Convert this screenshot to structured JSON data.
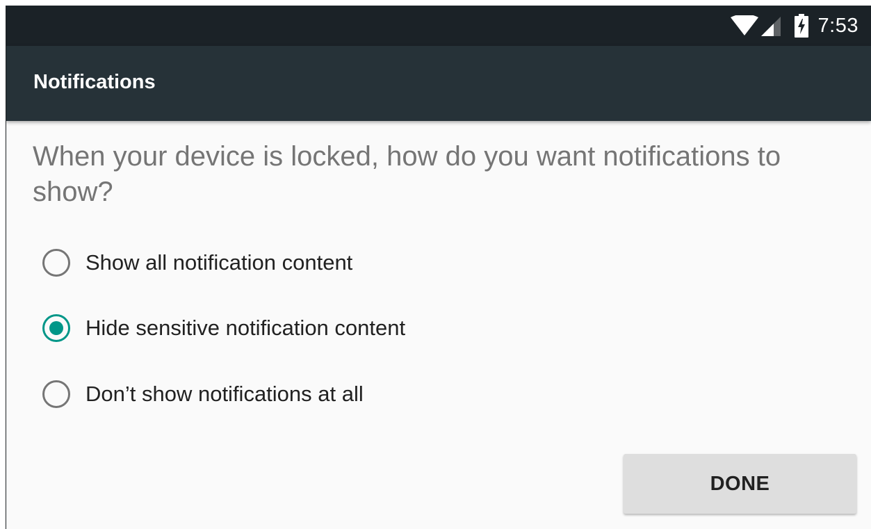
{
  "status_bar": {
    "time": "7:53",
    "icons": [
      "wifi-icon",
      "cellular-signal-icon",
      "battery-charging-icon"
    ]
  },
  "toolbar": {
    "title": "Notifications"
  },
  "question": "When your device is locked, how do you want notifications to show?",
  "options": [
    {
      "label": "Show all notification content",
      "checked": false
    },
    {
      "label": "Hide sensitive notification content",
      "checked": true
    },
    {
      "label": "Don’t show notifications at all",
      "checked": false
    }
  ],
  "done_label": "DONE",
  "colors": {
    "status_bar": "#1b2227",
    "toolbar": "#263238",
    "accent": "#009688",
    "background": "#fafafa",
    "button": "#dedede"
  }
}
